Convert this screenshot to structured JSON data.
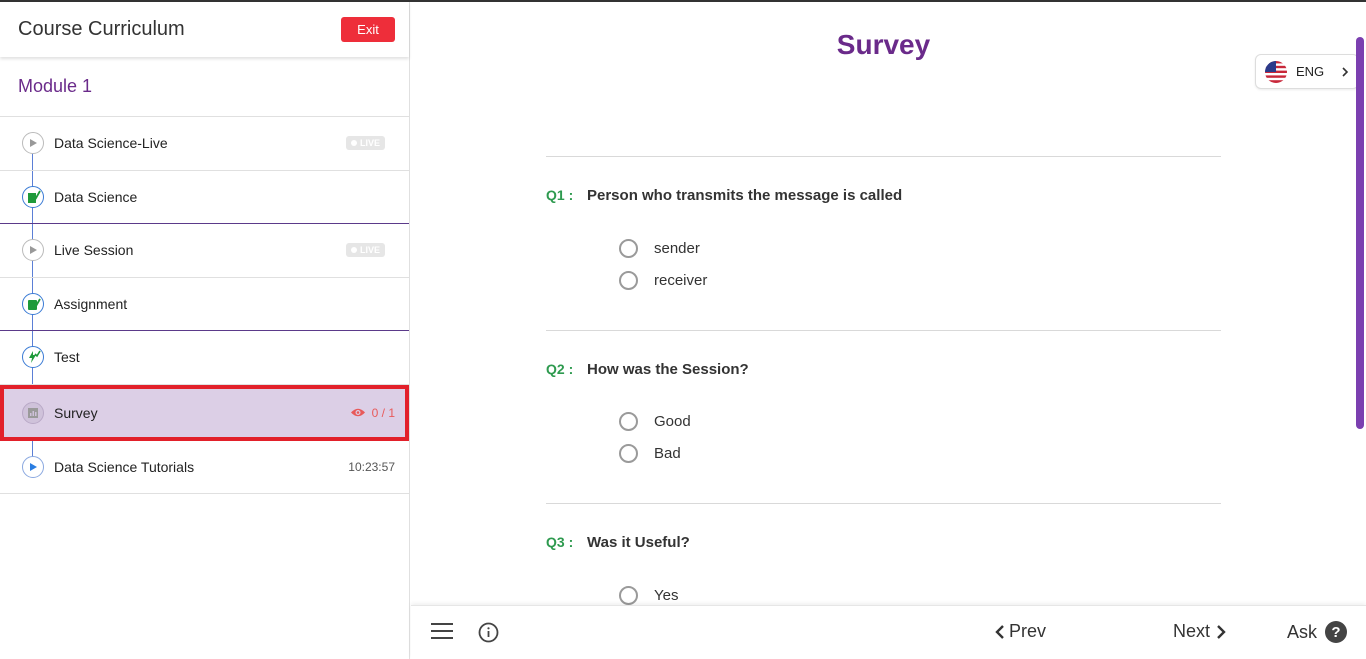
{
  "sidebar": {
    "title": "Course Curriculum",
    "exit_label": "Exit",
    "module_title": "Module 1",
    "items": [
      {
        "label": "Data Science-Live",
        "badge": "LIVE"
      },
      {
        "label": "Data Science"
      },
      {
        "label": "Live Session",
        "badge": "LIVE"
      },
      {
        "label": "Assignment"
      },
      {
        "label": "Test"
      },
      {
        "label": "Survey",
        "progress": "0 / 1"
      },
      {
        "label": "Data Science Tutorials",
        "duration": "10:23:57"
      }
    ]
  },
  "main": {
    "title": "Survey",
    "language": "ENG",
    "questions": [
      {
        "num": "Q1 :",
        "text": "Person who transmits the message is called",
        "options": [
          "sender",
          "receiver"
        ]
      },
      {
        "num": "Q2 :",
        "text": "How was the Session?",
        "options": [
          "Good",
          "Bad"
        ]
      },
      {
        "num": "Q3 :",
        "text": "Was it Useful?",
        "options": [
          "Yes"
        ]
      }
    ]
  },
  "footer": {
    "prev_label": "Prev",
    "next_label": "Next",
    "ask_label": "Ask",
    "ask_icon_glyph": "?"
  },
  "colors": {
    "accent_purple": "#6a2a8a",
    "exit_red": "#ee2e3a",
    "question_green": "#2e9a4f",
    "active_bg": "#dccfe6",
    "active_border": "#e2202a"
  }
}
